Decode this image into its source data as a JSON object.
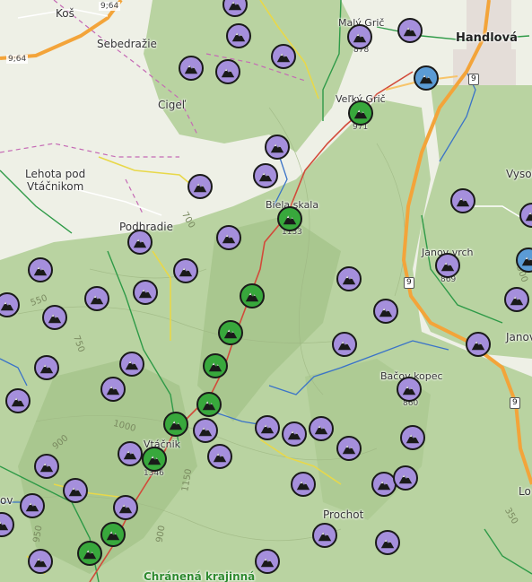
{
  "map": {
    "colors": {
      "forest": "#b9d3a1",
      "forest_dark": "#a9c78f",
      "open": "#eef0e6",
      "highway": "#f3a43a",
      "trail_red": "#d24a3a",
      "trail_yellow": "#e8d84a",
      "trail_green": "#2e9a47",
      "trail_blue": "#3a73c8",
      "boundary": "#c56ab5",
      "poi_purple": "#a58fdc",
      "poi_green": "#38a83c",
      "poi_blue": "#5b9bd5"
    },
    "places": [
      {
        "id": "kos",
        "label": "Koš",
        "kind": "village"
      },
      {
        "id": "sebedrazie",
        "label": "Sebedražie",
        "kind": "village"
      },
      {
        "id": "cigel",
        "label": "Cigeľ",
        "kind": "village"
      },
      {
        "id": "lehota",
        "label": "Lehota pod\nVtáčnikom",
        "kind": "village"
      },
      {
        "id": "podhradie",
        "label": "Podhradie",
        "kind": "village"
      },
      {
        "id": "handlova",
        "label": "Handlová",
        "kind": "town"
      },
      {
        "id": "maly-gric",
        "label": "Malý Grič",
        "kind": "peak"
      },
      {
        "id": "velky-gric",
        "label": "Veľký Grič",
        "kind": "peak"
      },
      {
        "id": "biela-skala",
        "label": "Biela skala",
        "kind": "peak"
      },
      {
        "id": "janov-vrch",
        "label": "Janov vrch",
        "kind": "peak"
      },
      {
        "id": "bacov-kopec",
        "label": "Bačov kopec",
        "kind": "peak"
      },
      {
        "id": "vtacnik",
        "label": "Vtáčnik",
        "kind": "peak"
      },
      {
        "id": "prochot",
        "label": "Prochot",
        "kind": "village"
      },
      {
        "id": "vysok",
        "label": "Vysok",
        "kind": "village"
      },
      {
        "id": "janov",
        "label": "Janov",
        "kind": "village"
      },
      {
        "id": "lo",
        "label": "Lo",
        "kind": "village"
      },
      {
        "id": "ov",
        "label": "ov",
        "kind": "village"
      },
      {
        "id": "chranena",
        "label": "Chránená krajinná",
        "kind": "area"
      }
    ],
    "elevations": [
      {
        "id": "maly-gric",
        "value": "878"
      },
      {
        "id": "velky-gric",
        "value": "971"
      },
      {
        "id": "biela-skala",
        "value": "1133"
      },
      {
        "id": "janov-vrch",
        "value": "869"
      },
      {
        "id": "bacov-kopec",
        "value": "860"
      },
      {
        "id": "vtacnik",
        "value": "1346"
      }
    ],
    "contour_labels": [
      "700",
      "550",
      "750",
      "1000",
      "900",
      "1150",
      "900",
      "950",
      "350",
      "500"
    ],
    "road_labels": {
      "shield_9_a": "9",
      "shield_9_b": "9",
      "shield_9_c": "9",
      "shield_9_d": "9",
      "road_964_a": "9;64",
      "road_964_b": "9;64"
    },
    "pois": [
      {
        "color": "purple",
        "icon": "mountain-icon"
      },
      {
        "color": "green",
        "icon": "mountain-icon"
      },
      {
        "color": "blue",
        "icon": "mountain-icon"
      }
    ]
  }
}
